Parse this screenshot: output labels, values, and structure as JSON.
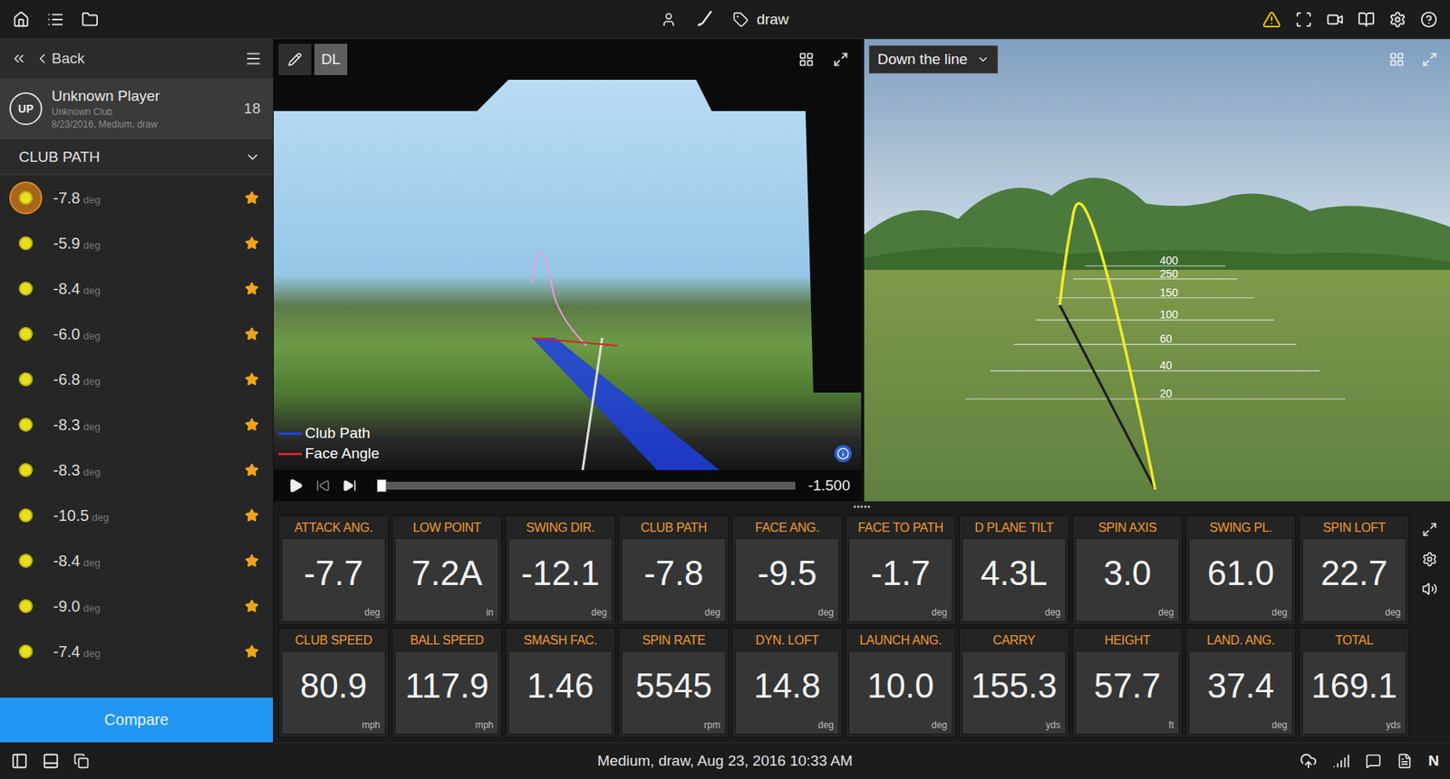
{
  "top_bar": {
    "session_tag": "draw"
  },
  "sidebar": {
    "back": "Back",
    "player": {
      "initials": "UP",
      "name": "Unknown Player",
      "club": "Unknown Club",
      "session": "8/23/2016, Medium, draw",
      "count": "18"
    },
    "section": "CLUB PATH",
    "shots": [
      {
        "value": "-7.8",
        "unit": "deg",
        "selected": true,
        "starred": true
      },
      {
        "value": "-5.9",
        "unit": "deg",
        "selected": false,
        "starred": true
      },
      {
        "value": "-8.4",
        "unit": "deg",
        "selected": false,
        "starred": true
      },
      {
        "value": "-6.0",
        "unit": "deg",
        "selected": false,
        "starred": true
      },
      {
        "value": "-6.8",
        "unit": "deg",
        "selected": false,
        "starred": true
      },
      {
        "value": "-8.3",
        "unit": "deg",
        "selected": false,
        "starred": true
      },
      {
        "value": "-8.3",
        "unit": "deg",
        "selected": false,
        "starred": true
      },
      {
        "value": "-10.5",
        "unit": "deg",
        "selected": false,
        "starred": true
      },
      {
        "value": "-8.4",
        "unit": "deg",
        "selected": false,
        "starred": true
      },
      {
        "value": "-9.0",
        "unit": "deg",
        "selected": false,
        "starred": true
      },
      {
        "value": "-7.4",
        "unit": "deg",
        "selected": false,
        "starred": true
      }
    ],
    "compare": "Compare"
  },
  "video": {
    "mode": {
      "label": "DL",
      "selected": true
    },
    "legend": [
      {
        "label": "Club Path",
        "color": "#1f3fe0"
      },
      {
        "label": "Face Angle",
        "color": "#e02020"
      }
    ],
    "time": "-1.500",
    "progress": 0
  },
  "simulator": {
    "view": "Down the line",
    "markers": [
      "400",
      "250",
      "150",
      "100",
      "60",
      "40",
      "20"
    ]
  },
  "metrics": [
    {
      "label": "ATTACK ANG.",
      "value": "-7.7",
      "unit": "deg"
    },
    {
      "label": "LOW POINT",
      "value": "7.2A",
      "unit": "in"
    },
    {
      "label": "SWING DIR.",
      "value": "-12.1",
      "unit": "deg"
    },
    {
      "label": "CLUB PATH",
      "value": "-7.8",
      "unit": "deg"
    },
    {
      "label": "FACE ANG.",
      "value": "-9.5",
      "unit": "deg"
    },
    {
      "label": "FACE TO PATH",
      "value": "-1.7",
      "unit": "deg"
    },
    {
      "label": "D PLANE TILT",
      "value": "4.3L",
      "unit": "deg"
    },
    {
      "label": "SPIN AXIS",
      "value": "3.0",
      "unit": "deg"
    },
    {
      "label": "SWING PL.",
      "value": "61.0",
      "unit": "deg"
    },
    {
      "label": "SPIN LOFT",
      "value": "22.7",
      "unit": "deg"
    },
    {
      "label": "CLUB SPEED",
      "value": "80.9",
      "unit": "mph"
    },
    {
      "label": "BALL SPEED",
      "value": "117.9",
      "unit": "mph"
    },
    {
      "label": "SMASH FAC.",
      "value": "1.46",
      "unit": ""
    },
    {
      "label": "SPIN RATE",
      "value": "5545",
      "unit": "rpm"
    },
    {
      "label": "DYN. LOFT",
      "value": "14.8",
      "unit": "deg"
    },
    {
      "label": "LAUNCH ANG.",
      "value": "10.0",
      "unit": "deg"
    },
    {
      "label": "CARRY",
      "value": "155.3",
      "unit": "yds"
    },
    {
      "label": "HEIGHT",
      "value": "57.7",
      "unit": "ft"
    },
    {
      "label": "LAND. ANG.",
      "value": "37.4",
      "unit": "deg"
    },
    {
      "label": "TOTAL",
      "value": "169.1",
      "unit": "yds"
    }
  ],
  "status_bar": {
    "text": "Medium, draw, Aug 23, 2016 10:33 AM",
    "badge": "N"
  }
}
